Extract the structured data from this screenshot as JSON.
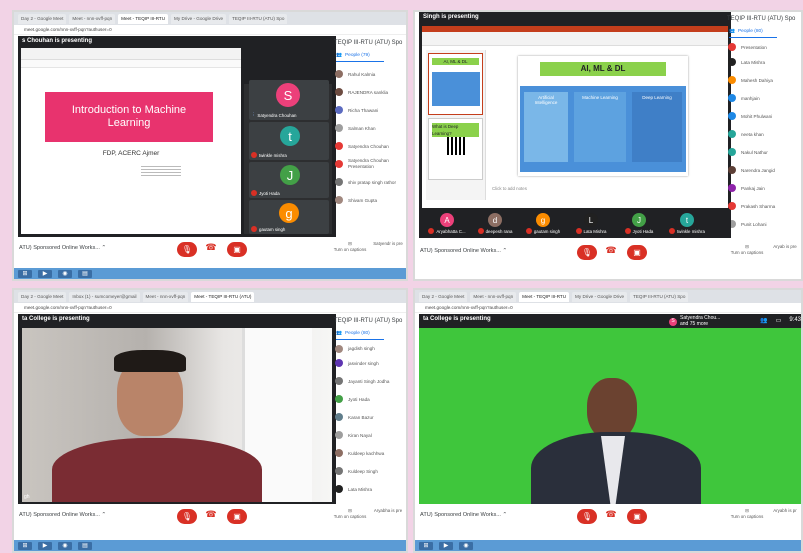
{
  "q1": {
    "tabs": [
      "Day 2 - Google Meet",
      "Meet - nnn-xvff-pqn",
      "Meet - TEQIP III-RTU",
      "My Drive - Google Drive",
      "TEQIP III-RTU (ATU) Spo"
    ],
    "url": "meet.google.com/nnn-xvff-pqn?authuser=0",
    "presenter": "s Chouhan is presenting",
    "meeting_title": "TEQIP III-RTU (ATU) Spo",
    "people_tab": "People (79)",
    "people": [
      {
        "name": "Rahul Kalmia",
        "color": "#8d6e63"
      },
      {
        "name": "RAJENDRA sanklia",
        "color": "#6d4c41"
      },
      {
        "name": "Richa Thawani",
        "color": "#5c6bc0"
      },
      {
        "name": "Salman Khan",
        "color": "#9e9e9e"
      },
      {
        "name": "Satyendra Chouhan",
        "color": "#e53935"
      },
      {
        "name": "Satyendra Chouhan",
        "sub": "Presentation",
        "color": "#e53935"
      },
      {
        "name": "shiv pratap singh rathor",
        "color": "#757575"
      },
      {
        "name": "Shivam Gupta",
        "color": "#a1887f"
      }
    ],
    "slide": {
      "title": "Introduction to Machine Learning",
      "subtitle": "FDP, ACERC Ajmer"
    },
    "tiles": [
      {
        "letter": "S",
        "name": "Satyendra Chouhan",
        "color": "#ec407a"
      },
      {
        "letter": "t",
        "name": "twinkle mishra",
        "color": "#26a69a"
      },
      {
        "letter": "J",
        "name": "Jyoti Hada",
        "color": "#43a047"
      },
      {
        "letter": "g",
        "name": "gautam singh",
        "color": "#fb8c00"
      }
    ],
    "meeting_name": "ATU) Sponsored Online Works...",
    "captions": "Turn on captions",
    "present_label": "Satyendr is pre"
  },
  "q2": {
    "presenter": "Singh is presenting",
    "meeting_title": "TEQIP III-RTU (ATU) Spo",
    "people_tab": "People (80)",
    "people": [
      {
        "name": "Presentation",
        "color": "#e53935"
      },
      {
        "name": "Lata Mishra",
        "color": "#212121"
      },
      {
        "name": "Mahesh Dahiya",
        "color": "#fb8c00"
      },
      {
        "name": "manhjain",
        "color": "#1e88e5"
      },
      {
        "name": "Mohit Phulwani",
        "color": "#1e88e5"
      },
      {
        "name": "neeta khan",
        "color": "#26a69a"
      },
      {
        "name": "Nakul Nathur",
        "color": "#26a69a"
      },
      {
        "name": "Narendra Jangid",
        "color": "#5d4037"
      },
      {
        "name": "Pankaj Jain",
        "color": "#8e24aa"
      },
      {
        "name": "Prakash Sharma",
        "color": "#e53935"
      },
      {
        "name": "Punit Lohani",
        "color": "#9e9e9e"
      }
    ],
    "slide": {
      "topic": "AI, ML & DL",
      "left_title": "AI, ML & DL",
      "question": "What is Deep Learning?",
      "box1": "Artificial Intelligence",
      "box2": "Machine Learning",
      "box3": "Deep Learning",
      "notes": "Click to add notes"
    },
    "strip": [
      {
        "letter": "A",
        "name": "Aryabhatta C...",
        "color": "#ec407a"
      },
      {
        "letter": "d",
        "name": "deepesh rana",
        "color": "#8d6e63"
      },
      {
        "letter": "g",
        "name": "gautam singh",
        "color": "#fb8c00"
      },
      {
        "letter": "L",
        "name": "Lata Mishra",
        "color": "#212121"
      },
      {
        "letter": "J",
        "name": "Jyoti Hada",
        "color": "#43a047"
      },
      {
        "letter": "t",
        "name": "twinkle mishra",
        "color": "#26a69a"
      }
    ],
    "meeting_name": "ATU) Sponsored Online Works...",
    "captions": "Turn on captions",
    "present_label": "Aryab is pre"
  },
  "q3": {
    "tabs": [
      "Day 2 - Google Meet",
      "Inbox (1) - sumcomeyer@gmail",
      "Meet - nnn-xvff-pqn",
      "Meet - TEQIP III-RTU (ATU)"
    ],
    "url": "meet.google.com/nnn-xvff-pqn?authuser=0",
    "presenter": "ta College is presenting",
    "meeting_title": "TEQIP III-RTU (ATU) Spo",
    "people_tab": "People (80)",
    "people": [
      {
        "name": "jagdish singh",
        "color": "#a1887f"
      },
      {
        "name": "jasvinder singh",
        "color": "#5e35b1"
      },
      {
        "name": "Jayanti Singh Jodha",
        "color": "#757575"
      },
      {
        "name": "Jyoti Hada",
        "color": "#43a047"
      },
      {
        "name": "Karan Bazur",
        "color": "#607d8b"
      },
      {
        "name": "Kiran Nayal",
        "color": "#9e9e9e"
      },
      {
        "name": "Kuldeep kachhwa",
        "color": "#8d6e63"
      },
      {
        "name": "Kuldeep Singh",
        "color": "#757575"
      },
      {
        "name": "Lata Mishra",
        "color": "#212121"
      }
    ],
    "video_label": "gh",
    "meeting_name": "ATU) Sponsored Online Works...",
    "captions": "Turn on captions",
    "present_label": "Aryabha is pre"
  },
  "q4": {
    "tabs": [
      "Day 2 - Google Meet",
      "Meet - nnn-xvff-pqn",
      "Meet - TEQIP III-RTU",
      "My Drive - Google Drive",
      "TEQIP III-RTU (ATU) Spo"
    ],
    "url": "meet.google.com/nnn-xvff-pqn?authuser=0",
    "presenter": "ta College is presenting",
    "top_participant": "Satyendra Chou...",
    "top_more": "and 75 more",
    "time": "9:43",
    "meeting_name": "ATU) Sponsored Online Works...",
    "captions": "Turn on captions",
    "present_label": "Aryabh is pr"
  }
}
